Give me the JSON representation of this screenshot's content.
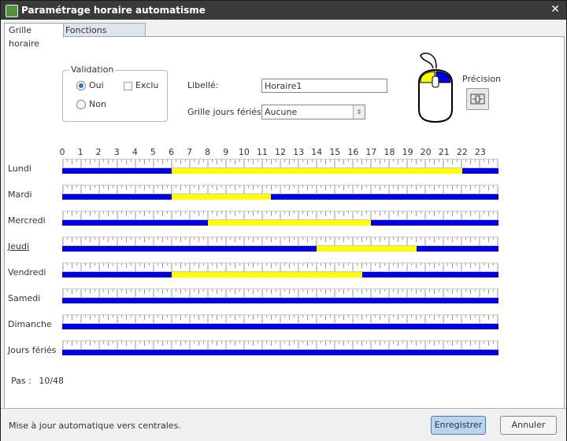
{
  "window": {
    "title": "Paramétrage horaire automatisme",
    "close_glyph": "✕"
  },
  "tabs": [
    {
      "label": "Grille horaire",
      "active": true
    },
    {
      "label": "Fonctions avancées",
      "active": false
    }
  ],
  "validation": {
    "legend": "Validation",
    "oui_label": "Oui",
    "oui_selected": true,
    "non_label": "Non",
    "non_selected": false,
    "exclu_label": "Exclu",
    "exclu_checked": false
  },
  "libelle": {
    "label": "Libellé:",
    "value": "Horaire1"
  },
  "grille_feries": {
    "label": "Grille jours fériés:",
    "value": "Aucune"
  },
  "precision": {
    "label": "Précision"
  },
  "hours": [
    "0",
    "1",
    "2",
    "3",
    "4",
    "5",
    "6",
    "7",
    "8",
    "9",
    "10",
    "11",
    "12",
    "13",
    "14",
    "15",
    "16",
    "17",
    "18",
    "19",
    "20",
    "21",
    "22",
    "23"
  ],
  "schedule": {
    "slots_per_day": 48,
    "active_color": "#ffff00",
    "inactive_color": "#0000e0",
    "days": [
      {
        "label": "Lundi",
        "underline": false,
        "ranges": [
          [
            12,
            44
          ]
        ]
      },
      {
        "label": "Mardi",
        "underline": false,
        "ranges": [
          [
            12,
            23
          ]
        ]
      },
      {
        "label": "Mercredi",
        "underline": false,
        "ranges": [
          [
            16,
            34
          ]
        ]
      },
      {
        "label": "Jeudi",
        "underline": true,
        "ranges": [
          [
            28,
            39
          ]
        ]
      },
      {
        "label": "Vendredi",
        "underline": false,
        "ranges": [
          [
            12,
            33
          ]
        ]
      },
      {
        "label": "Samedi",
        "underline": false,
        "ranges": []
      },
      {
        "label": "Dimanche",
        "underline": false,
        "ranges": []
      },
      {
        "label": "Jours fériés",
        "underline": false,
        "ranges": []
      }
    ]
  },
  "pas": {
    "label": "Pas :",
    "value": "10/48"
  },
  "footer": {
    "status": "Mise à jour automatique vers centrales.",
    "save_label": "Enregistrer",
    "cancel_label": "Annuler"
  },
  "colors": {
    "titlebar": "#3a3a3a",
    "mouse_highlight": "#ffff00",
    "mouse_blue": "#0000e0"
  }
}
